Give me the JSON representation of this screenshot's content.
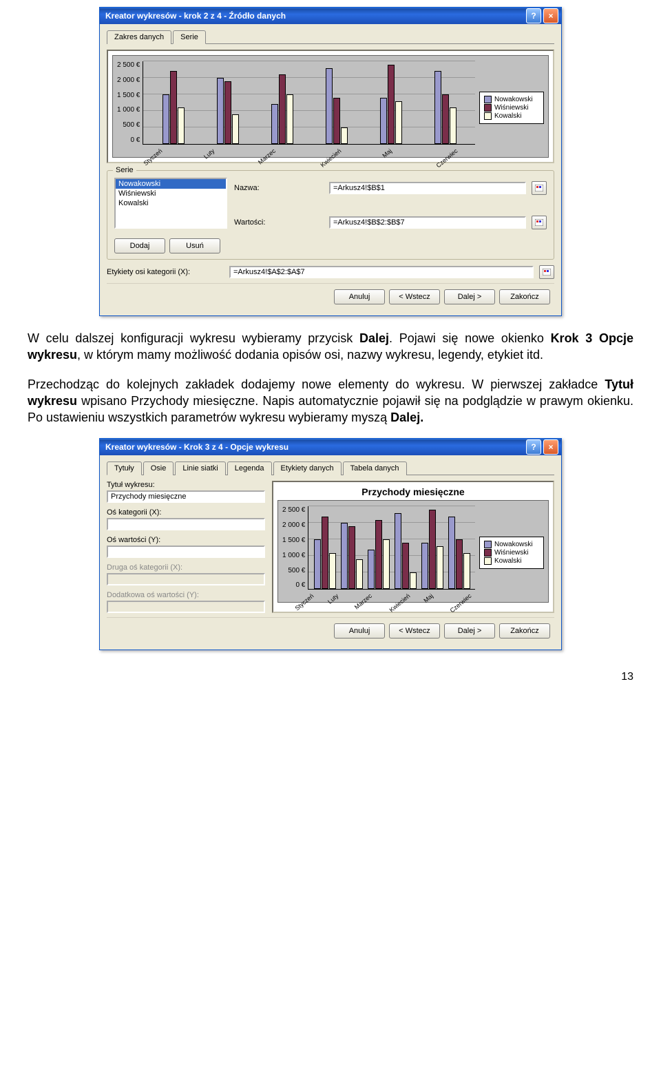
{
  "dialog1": {
    "title": "Kreator wykresów - krok 2 z 4 - Źródło danych",
    "tabs": {
      "range": "Zakres danych",
      "series": "Serie"
    },
    "series_label": "Serie",
    "series_items": [
      "Nowakowski",
      "Wiśniewski",
      "Kowalski"
    ],
    "add_btn": "Dodaj",
    "remove_btn": "Usuń",
    "name_label": "Nazwa:",
    "name_value": "=Arkusz4!$B$1",
    "values_label": "Wartości:",
    "values_value": "=Arkusz4!$B$2:$B$7",
    "xlabels_label": "Etykiety osi kategorii (X):",
    "xlabels_value": "=Arkusz4!$A$2:$A$7"
  },
  "dialog2": {
    "title": "Kreator wykresów - Krok 3 z 4 - Opcje wykresu",
    "tabs": [
      "Tytuły",
      "Osie",
      "Linie siatki",
      "Legenda",
      "Etykiety danych",
      "Tabela danych"
    ],
    "chart_title_label": "Tytuł wykresu:",
    "chart_title_value": "Przychody miesięczne",
    "xaxis_label": "Oś kategorii (X):",
    "xaxis_value": "",
    "yaxis_label": "Oś wartości (Y):",
    "yaxis_value": "",
    "xaxis2_label": "Druga oś kategorii (X):",
    "yaxis2_label": "Dodatkowa oś wartości (Y):",
    "preview_title": "Przychody miesięczne"
  },
  "footer_buttons": {
    "cancel": "Anuluj",
    "back": "< Wstecz",
    "next": "Dalej >",
    "finish": "Zakończ"
  },
  "paragraphs": {
    "p1_a": "W celu dalszej konfiguracji wykresu wybieramy przycisk ",
    "p1_b": "Dalej",
    "p1_c": ". Pojawi się nowe okienko ",
    "p1_d": "Krok 3 Opcje wykresu",
    "p1_e": ", w którym mamy możliwość dodania opisów osi, nazwy wykresu, legendy, etykiet itd.",
    "p2_a": "Przechodząc do kolejnych zakładek dodajemy nowe elementy do wykresu. W pierwszej zakładce ",
    "p2_b": "Tytuł wykresu",
    "p2_c": " wpisano Przychody miesięczne. Napis automatycznie pojawił się na podglądzie w prawym okienku. Po ustawieniu wszystkich parametrów wykresu wybieramy myszą ",
    "p2_d": "Dalej."
  },
  "page_number": "13",
  "chart_data": {
    "type": "bar",
    "title": "",
    "categories": [
      "Styczeń",
      "Luty",
      "Marzec",
      "Kwiecień",
      "Maj",
      "Czerwiec"
    ],
    "series": [
      {
        "name": "Nowakowski",
        "values": [
          1500,
          2000,
          1200,
          2300,
          1400,
          2200
        ]
      },
      {
        "name": "Wiśniewski",
        "values": [
          2200,
          1900,
          2100,
          1400,
          2400,
          1500
        ]
      },
      {
        "name": "Kowalski",
        "values": [
          1100,
          900,
          1500,
          500,
          1300,
          1100
        ]
      }
    ],
    "ylabel": "",
    "xlabel": "",
    "ylim": [
      0,
      2500
    ],
    "yticks": [
      "2 500 €",
      "2 000 €",
      "1 500 €",
      "1 000 €",
      "500 €",
      "0 €"
    ]
  }
}
